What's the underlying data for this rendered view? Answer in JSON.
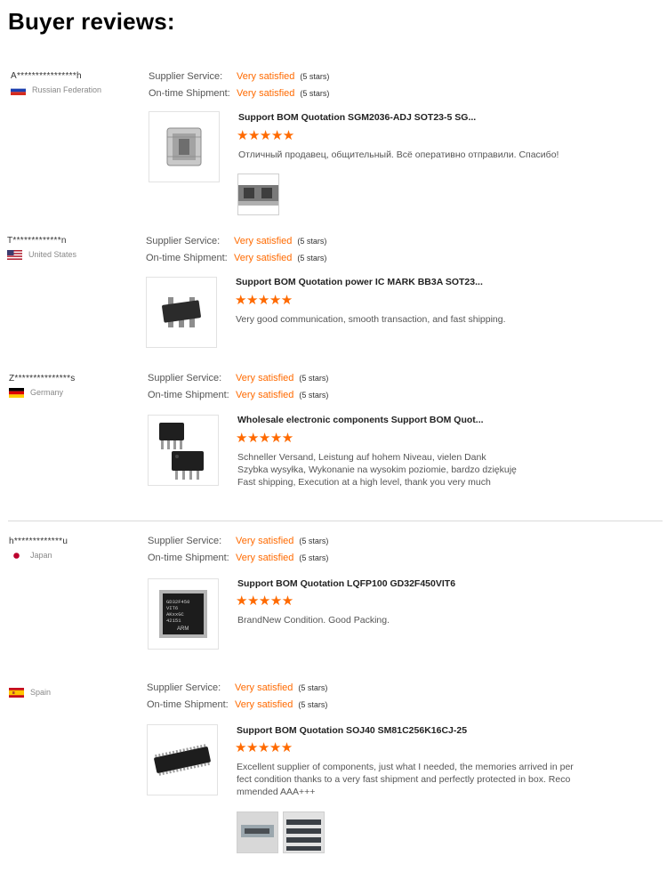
{
  "page": {
    "title": "Buyer reviews:"
  },
  "labels": {
    "supplier_service": "Supplier Service:",
    "on_time_shipment": "On-time Shipment:"
  },
  "colors": {
    "accent": "#ff6a00"
  },
  "reviews": [
    {
      "user": "A****************h",
      "country": "Russian Federation",
      "flag": "russia-flag-icon",
      "supplier_rating": "Very satisfied",
      "supplier_stars": "(5 stars)",
      "shipment_rating": "Very satisfied",
      "shipment_stars": "(5 stars)",
      "product_title": "Support BOM Quotation SGM2036-ADJ SOT23-5 SG...",
      "stars": "★★★★★",
      "comment": "Отличный продавец, общительный. Всё оперативно отправили. Спасибо!"
    },
    {
      "user": "T*************n",
      "country": "United States",
      "flag": "usa-flag-icon",
      "supplier_rating": "Very satisfied",
      "supplier_stars": "(5 stars)",
      "shipment_rating": "Very satisfied",
      "shipment_stars": "(5 stars)",
      "product_title": "Support BOM Quotation power IC MARK BB3A SOT23...",
      "stars": "★★★★★",
      "comment": "Very good communication, smooth transaction, and fast shipping."
    },
    {
      "user": "Z***************s",
      "country": "Germany",
      "flag": "germany-flag-icon",
      "supplier_rating": "Very satisfied",
      "supplier_stars": "(5 stars)",
      "shipment_rating": "Very satisfied",
      "shipment_stars": "(5 stars)",
      "product_title": "Wholesale electronic components Support BOM Quot...",
      "stars": "★★★★★",
      "comment_lines": [
        "Schneller Versand, Leistung auf hohem Niveau, vielen Dank",
        "Szybka wysyłka, Wykonanie na wysokim poziomie, bardzo dziękuję",
        "Fast shipping, Execution at a high level, thank you very much"
      ]
    },
    {
      "user": "h*************u",
      "country": "Japan",
      "flag": "japan-flag-icon",
      "supplier_rating": "Very satisfied",
      "supplier_stars": "(5 stars)",
      "shipment_rating": "Very satisfied",
      "shipment_stars": "(5 stars)",
      "product_title": "Support BOM Quotation LQFP100 GD32F450VIT6",
      "stars": "★★★★★",
      "comment": "BrandNew Condition. Good Packing.",
      "chip_marking": [
        "GD32F450",
        "VIT6",
        "AKxxGC",
        "42151"
      ],
      "chip_logo": "ARM"
    },
    {
      "user": "",
      "country": "Spain",
      "flag": "spain-flag-icon",
      "supplier_rating": "Very satisfied",
      "supplier_stars": "(5 stars)",
      "shipment_rating": "Very satisfied",
      "shipment_stars": "(5 stars)",
      "product_title": "Support BOM Quotation SOJ40 SM81C256K16CJ-25",
      "stars": "★★★★★",
      "comment_lines": [
        "Excellent supplier of components, just what I needed, the memories arrived in per",
        "fect condition thanks to a very fast shipment and perfectly protected in box. Reco",
        "mmended AAA+++"
      ]
    }
  ]
}
